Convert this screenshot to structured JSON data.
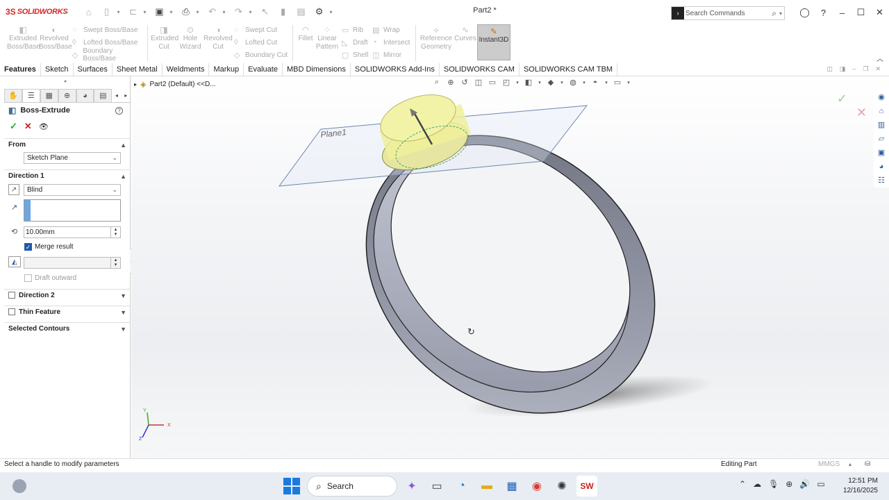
{
  "app": {
    "logo_prefix": "3S",
    "logo_name": "SOLIDWORKS",
    "document_title": "Part2 *",
    "search_placeholder": "Search Commands"
  },
  "command_manager": {
    "buttons": [
      {
        "label": "Extruded Boss/Base",
        "icon": "extrude-icon"
      },
      {
        "label": "Revolved Boss/Base",
        "icon": "revolve-icon"
      }
    ],
    "boss_group": [
      "Swept Boss/Base",
      "Lofted Boss/Base",
      "Boundary Boss/Base"
    ],
    "cut_buttons": [
      {
        "label": "Extruded Cut",
        "icon": "extruded-cut-icon"
      },
      {
        "label": "Hole Wizard",
        "icon": "hole-wizard-icon"
      },
      {
        "label": "Revolved Cut",
        "icon": "revolved-cut-icon"
      }
    ],
    "cut_group": [
      "Swept Cut",
      "Lofted Cut",
      "Boundary Cut"
    ],
    "fillet": "Fillet",
    "linear_pattern": "Linear Pattern",
    "feature_group": [
      "Rib",
      "Draft",
      "Shell"
    ],
    "feature_group2": [
      "Wrap",
      "Intersect",
      "Mirror"
    ],
    "reference_geometry": "Reference Geometry",
    "curves": "Curves",
    "instant3d": "Instant3D"
  },
  "tabs": [
    "Features",
    "Sketch",
    "Surfaces",
    "Sheet Metal",
    "Weldments",
    "Markup",
    "Evaluate",
    "MBD Dimensions",
    "SOLIDWORKS Add-Ins",
    "SOLIDWORKS CAM",
    "SOLIDWORKS CAM TBM"
  ],
  "active_tab": "Features",
  "property_manager": {
    "title": "Boss-Extrude",
    "help": "?",
    "from": {
      "heading": "From",
      "value": "Sketch Plane"
    },
    "direction1": {
      "heading": "Direction 1",
      "end_condition": "Blind",
      "depth": "10.00mm",
      "merge_result": "Merge result",
      "merge_checked": true,
      "draft_outward": "Draft outward"
    },
    "direction2": "Direction 2",
    "thin_feature": "Thin Feature",
    "selected_contours": "Selected Contours"
  },
  "viewport": {
    "breadcrumb": "Part2 (Default) <<D...",
    "plane_label": "Plane1",
    "triad": {
      "x": "X",
      "y": "Y",
      "z": "Z"
    }
  },
  "status_bar": {
    "message": "Select a handle to modify parameters",
    "mode": "Editing Part",
    "units": "MMGS"
  },
  "taskbar": {
    "search": "Search",
    "time": "12:51 PM",
    "date": "12/16/2025"
  },
  "colors": {
    "accent": "#1e5aa8",
    "brand_red": "#dd2222",
    "ring_body": "#a9adbb",
    "preview_yellow": "#f0f0a0"
  }
}
